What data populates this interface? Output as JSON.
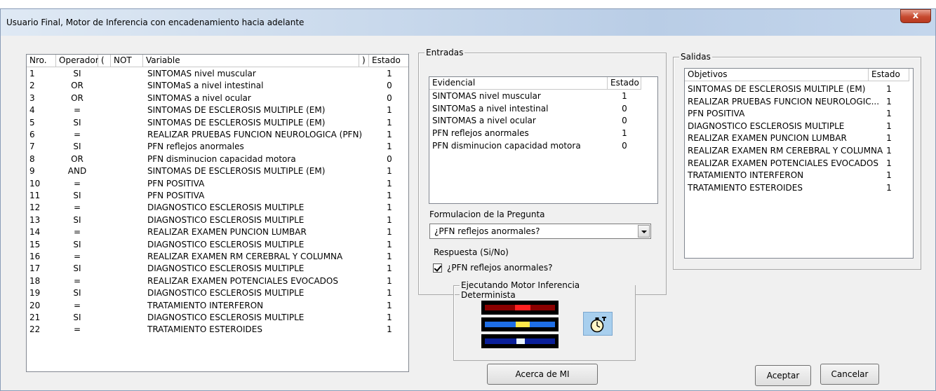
{
  "window": {
    "title": "Usuario Final, Motor de Inferencia con encadenamiento hacia adelante",
    "close_glyph": "x"
  },
  "rules": {
    "headers": {
      "nro": "Nro.",
      "operador": "Operador",
      "open_paren": "(",
      "not": "NOT",
      "variable": "Variable",
      "close_paren": ")",
      "estado": "Estado"
    },
    "rows": [
      {
        "nro": "1",
        "op": "SI",
        "var": "SINTOMAS  nivel muscular",
        "estado": "1"
      },
      {
        "nro": "2",
        "op": "OR",
        "var": "SINTOMaS a nivel intestinal",
        "estado": "0"
      },
      {
        "nro": "3",
        "op": "OR",
        "var": "SINTOMAS a nivel ocular",
        "estado": "0"
      },
      {
        "nro": "4",
        "op": "=",
        "var": "SINTOMAS DE ESCLEROSIS MULTIPLE (EM)",
        "estado": "1"
      },
      {
        "nro": "5",
        "op": "SI",
        "var": "SINTOMAS DE ESCLEROSIS MULTIPLE (EM)",
        "estado": "1"
      },
      {
        "nro": "6",
        "op": "=",
        "var": "REALIZAR PRUEBAS FUNCION NEUROLOGICA (PFN)",
        "estado": "1"
      },
      {
        "nro": "7",
        "op": "SI",
        "var": "PFN reflejos anormales",
        "estado": "1"
      },
      {
        "nro": "8",
        "op": "OR",
        "var": "PFN disminucion capacidad motora",
        "estado": "0"
      },
      {
        "nro": "9",
        "op": "AND",
        "var": "SINTOMAS DE ESCLEROSIS MULTIPLE (EM)",
        "estado": "1"
      },
      {
        "nro": "10",
        "op": "=",
        "var": "PFN POSITIVA",
        "estado": "1"
      },
      {
        "nro": "11",
        "op": "SI",
        "var": "PFN POSITIVA",
        "estado": "1"
      },
      {
        "nro": "12",
        "op": "=",
        "var": "DIAGNOSTICO ESCLEROSIS MULTIPLE",
        "estado": "1"
      },
      {
        "nro": "13",
        "op": "SI",
        "var": "DIAGNOSTICO ESCLEROSIS MULTIPLE",
        "estado": "1"
      },
      {
        "nro": "14",
        "op": "=",
        "var": "REALIZAR EXAMEN PUNCION LUMBAR",
        "estado": "1"
      },
      {
        "nro": "15",
        "op": "SI",
        "var": "DIAGNOSTICO ESCLEROSIS MULTIPLE",
        "estado": "1"
      },
      {
        "nro": "16",
        "op": "=",
        "var": "REALIZAR EXAMEN RM CEREBRAL Y COLUMNA",
        "estado": "1"
      },
      {
        "nro": "17",
        "op": "SI",
        "var": "DIAGNOSTICO ESCLEROSIS MULTIPLE",
        "estado": "1"
      },
      {
        "nro": "18",
        "op": "=",
        "var": "REALIZAR EXAMEN POTENCIALES EVOCADOS",
        "estado": "1"
      },
      {
        "nro": "19",
        "op": "SI",
        "var": "DIAGNOSTICO ESCLEROSIS MULTIPLE",
        "estado": "1"
      },
      {
        "nro": "20",
        "op": "=",
        "var": "TRATAMIENTO INTERFERON",
        "estado": "1"
      },
      {
        "nro": "21",
        "op": "SI",
        "var": "DIAGNOSTICO ESCLEROSIS MULTIPLE",
        "estado": "1"
      },
      {
        "nro": "22",
        "op": "=",
        "var": "TRATAMIENTO ESTEROIDES",
        "estado": "1"
      }
    ]
  },
  "entradas": {
    "title": "Entradas",
    "headers": {
      "evidencial": "Evidencial",
      "estado": "Estado"
    },
    "rows": [
      {
        "ev": "SINTOMAS  nivel muscular",
        "estado": "1"
      },
      {
        "ev": "SINTOMaS a nivel intestinal",
        "estado": "0"
      },
      {
        "ev": "SINTOMAS a nivel ocular",
        "estado": "0"
      },
      {
        "ev": "PFN reflejos anormales",
        "estado": "1"
      },
      {
        "ev": "PFN disminucion capacidad motora",
        "estado": "0"
      }
    ],
    "formulacion_label": "Formulacion de la Pregunta",
    "pregunta_selected": "¿PFN reflejos anormales?",
    "respuesta_label": "Respuesta (Si/No)",
    "respuesta_check_label": "¿PFN reflejos anormales?",
    "respuesta_checked": true
  },
  "salidas": {
    "title": "Salidas",
    "headers": {
      "objetivos": "Objetivos",
      "estado": "Estado"
    },
    "rows": [
      {
        "obj": "SINTOMAS DE ESCLEROSIS MULTIPLE (EM)",
        "estado": "1"
      },
      {
        "obj": "REALIZAR PRUEBAS FUNCION NEUROLOGIC...",
        "estado": "1"
      },
      {
        "obj": "PFN POSITIVA",
        "estado": "1"
      },
      {
        "obj": "DIAGNOSTICO ESCLEROSIS MULTIPLE",
        "estado": "1"
      },
      {
        "obj": "REALIZAR EXAMEN PUNCION LUMBAR",
        "estado": "1"
      },
      {
        "obj": "REALIZAR EXAMEN RM CEREBRAL Y COLUMNA",
        "estado": "1"
      },
      {
        "obj": "REALIZAR EXAMEN POTENCIALES EVOCADOS",
        "estado": "1"
      },
      {
        "obj": "TRATAMIENTO INTERFERON",
        "estado": "1"
      },
      {
        "obj": "TRATAMIENTO ESTEROIDES",
        "estado": "1"
      }
    ]
  },
  "motor": {
    "title": "Ejecutando Motor Inferencia Determinista",
    "icon": "stopwatch-icon",
    "colors": {
      "red_lane": "#8b0000",
      "red_hl": "#ff2020",
      "blue_lane": "#1e6ee6",
      "yellow_hl": "#ffe84a",
      "navy_lane": "#0a1f9a",
      "white_hl": "#e8f4ff"
    }
  },
  "buttons": {
    "about": "Acerca de MI",
    "accept": "Aceptar",
    "cancel": "Cancelar"
  }
}
